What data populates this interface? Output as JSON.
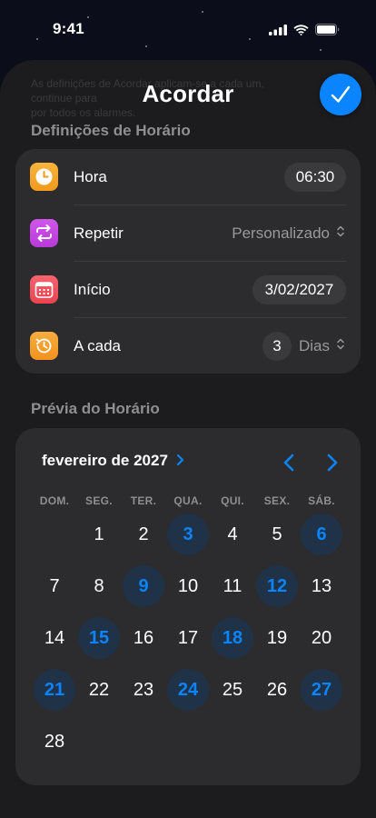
{
  "status_bar": {
    "time": "9:41"
  },
  "sheet": {
    "ghost_text": "As definições de Acordar aplicam-se a cada um, continue para\npor todos os alarmes.",
    "title": "Acordar"
  },
  "schedule_settings": {
    "header": "Definições de Horário",
    "rows": [
      {
        "label": "Hora",
        "value": "06:30",
        "icon": "clock-icon",
        "color": "#f5a623"
      },
      {
        "label": "Repetir",
        "value": "Personalizado",
        "icon": "repeat-icon",
        "color": "#c644e3"
      },
      {
        "label": "Início",
        "value": "3/02/2027",
        "icon": "calendar-icon",
        "color": "#f0505b"
      },
      {
        "label": "A cada",
        "value": "3",
        "unit": "Dias",
        "icon": "history-icon",
        "color": "#f5a030"
      }
    ]
  },
  "preview": {
    "header": "Prévia do Horário",
    "month": "fevereiro de 2027",
    "weekdays": [
      "DOM.",
      "SEG.",
      "TER.",
      "QUA.",
      "QUI.",
      "SEX.",
      "SÁB."
    ],
    "first_weekday_index": 1,
    "days_in_month": 28,
    "highlighted_days": [
      3,
      6,
      9,
      12,
      15,
      18,
      21,
      24,
      27
    ]
  },
  "colors": {
    "accent": "#0a84ff",
    "card": "#2c2c2e",
    "sheet": "#1c1c1e"
  }
}
